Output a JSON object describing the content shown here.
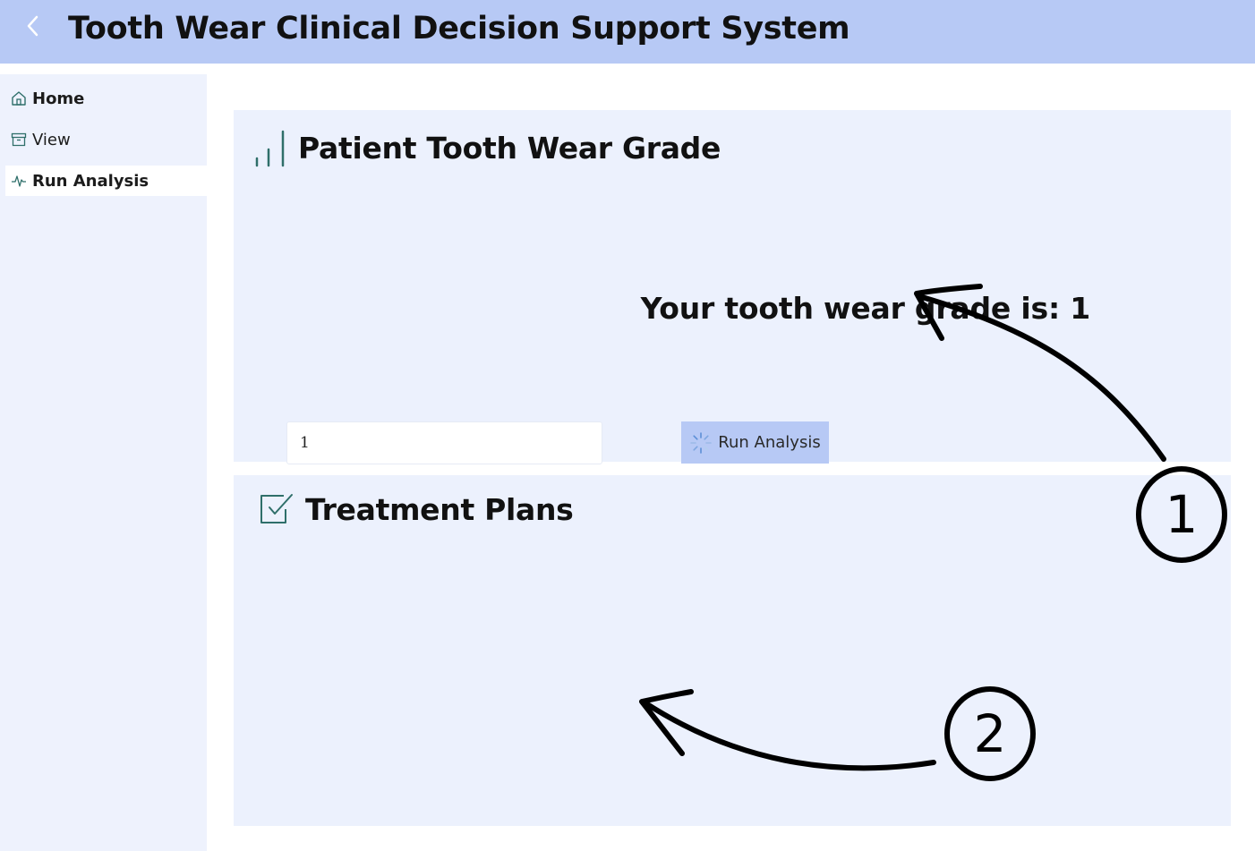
{
  "header": {
    "title": "Tooth Wear Clinical Decision Support System",
    "back_icon": "chevron-left-icon"
  },
  "sidebar": {
    "items": [
      {
        "label": "Home",
        "icon": "home-icon",
        "active": false
      },
      {
        "label": "View",
        "icon": "archive-box-icon",
        "active": false
      },
      {
        "label": "Run Analysis",
        "icon": "activity-pulse-icon",
        "active": true
      }
    ]
  },
  "grade_card": {
    "title": "Patient Tooth Wear Grade",
    "icon": "bar-chart-icon",
    "result_text": "Your tooth wear grade is: 1",
    "input_value": "1",
    "run_button_label": "Run Analysis",
    "run_button_icon": "loading-spinner-icon"
  },
  "treatment_card": {
    "title": "Treatment Plans",
    "icon": "checkbox-checked-icon"
  },
  "annotations": {
    "marker_1": "1",
    "marker_2": "2"
  },
  "colors": {
    "header_bg": "#b7c9f5",
    "sidebar_bg": "#eef2fd",
    "card_bg": "#ecf1fd",
    "icon_teal": "#2f6f6a"
  }
}
